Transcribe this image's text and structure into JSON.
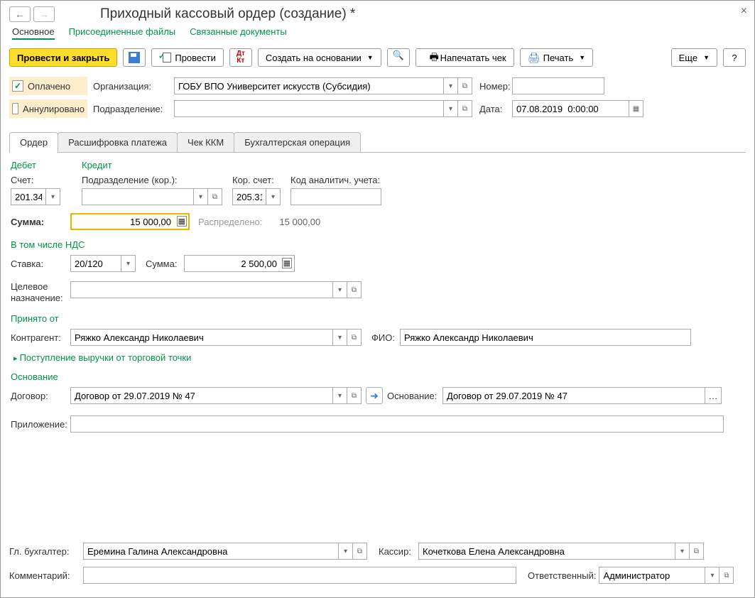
{
  "title": "Приходный кассовый ордер (создание) *",
  "nav_tabs": {
    "main": "Основное",
    "files": "Присоединенные файлы",
    "related": "Связанные документы"
  },
  "toolbar": {
    "post_close": "Провести и закрыть",
    "post": "Провести",
    "create_based": "Создать на основании",
    "print_receipt": "Напечатать чек",
    "print": "Печать",
    "more": "Еще",
    "help": "?"
  },
  "status": {
    "paid": "Оплачено",
    "cancelled": "Аннулировано"
  },
  "header": {
    "org_label": "Организация:",
    "org_value": "ГОБУ ВПО Университет искусств (Субсидия)",
    "dept_label": "Подразделение:",
    "dept_value": "",
    "num_label": "Номер:",
    "num_value": "",
    "date_label": "Дата:",
    "date_value": "07.08.2019  0:00:00"
  },
  "doc_tabs": {
    "order": "Ордер",
    "breakdown": "Расшифровка платежа",
    "kkm": "Чек ККМ",
    "acc_op": "Бухгалтерская операция"
  },
  "debit": {
    "title": "Дебет",
    "account_label": "Счет:",
    "account_value": "201.34",
    "sum_label": "Сумма:",
    "sum_value": "15 000,00"
  },
  "credit": {
    "title": "Кредит",
    "dept_label": "Подразделение (кор.):",
    "dept_value": "",
    "account_label": "Кор. счет:",
    "account_value": "205.31",
    "analytic_label": "Код аналитич. учета:",
    "analytic_value": "",
    "distributed_label": "Распределено:",
    "distributed_value": "15 000,00"
  },
  "nds": {
    "title": "В том числе НДС",
    "rate_label": "Ставка:",
    "rate_value": "20/120",
    "sum_label": "Сумма:",
    "sum_value": "2 500,00"
  },
  "purpose": {
    "label": "Целевое назначение:"
  },
  "received": {
    "title": "Принято от",
    "contractor_label": "Контрагент:",
    "contractor_value": "Ряжко Александр Николаевич",
    "fio_label": "ФИО:",
    "fio_value": "Ряжко Александр Николаевич",
    "expand_link": "Поступление выручки от торговой точки"
  },
  "basis": {
    "title": "Основание",
    "contract_label": "Договор:",
    "contract_value": "Договор от 29.07.2019 № 47",
    "basis_label": "Основание:",
    "basis_value": "Договор от 29.07.2019 № 47",
    "attachment_label": "Приложение:",
    "attachment_value": ""
  },
  "footer": {
    "accountant_label": "Гл. бухгалтер:",
    "accountant_value": "Еремина Галина Александровна",
    "cashier_label": "Кассир:",
    "cashier_value": "Кочеткова Елена Александровна",
    "comment_label": "Комментарий:",
    "comment_value": "",
    "responsible_label": "Ответственный:",
    "responsible_value": "Администратор"
  }
}
